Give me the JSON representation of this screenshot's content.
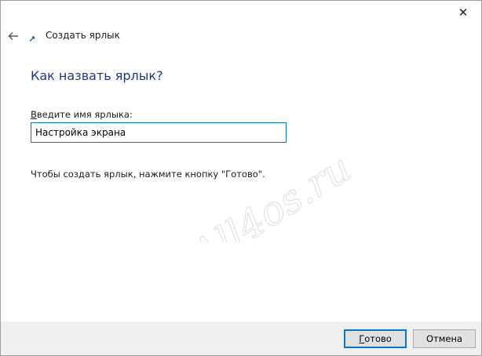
{
  "window": {
    "close_glyph": "✕"
  },
  "header": {
    "title": "Создать ярлык"
  },
  "page": {
    "heading": "Как назвать ярлык?",
    "field_label_mnemonic": "В",
    "field_label_rest": "ведите имя ярлыка:",
    "field_value": "Настройка экрана",
    "instruction": "Чтобы создать ярлык, нажмите кнопку \"Готово\"."
  },
  "watermark": {
    "text": "All4os.ru"
  },
  "footer": {
    "finish_mnemonic": "Г",
    "finish_rest": "отово",
    "cancel_label": "Отмена"
  },
  "colors": {
    "accent": "#0078d7",
    "heading": "#1c3a8c",
    "footer_bg": "#f0f0f0"
  }
}
